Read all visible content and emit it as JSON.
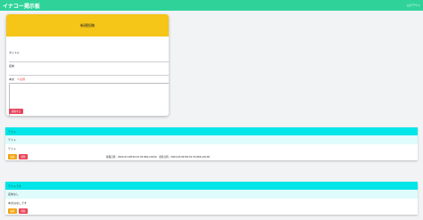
{
  "app": {
    "title": "イナコー掲示板",
    "right_link": "ログアウト"
  },
  "form": {
    "header": "新規投稿",
    "title_label": "タイトル",
    "name_label": "名前",
    "body_label": "本文",
    "required_mark": "＊必須",
    "submit_label": "投稿する"
  },
  "posts": [
    {
      "title": "テスト",
      "name": "テスト",
      "body": "テスト",
      "edit_label": "編集",
      "delete_label": "削除",
      "meta": "投稿日時：2024-03-04T20:01:55.894+09:00　更新日時：2024-03-04T20:01:55.894+09:00"
    },
    {
      "title": "テストです",
      "name": "名前なし",
      "body": "本文はなしです",
      "edit_label": "編集",
      "delete_label": "削除"
    }
  ],
  "colors": {
    "topbar": "#2fd39a",
    "form_header": "#f5c518",
    "post_header": "#00e5e8",
    "danger": "#e8445a",
    "warning": "#f2a30f"
  }
}
